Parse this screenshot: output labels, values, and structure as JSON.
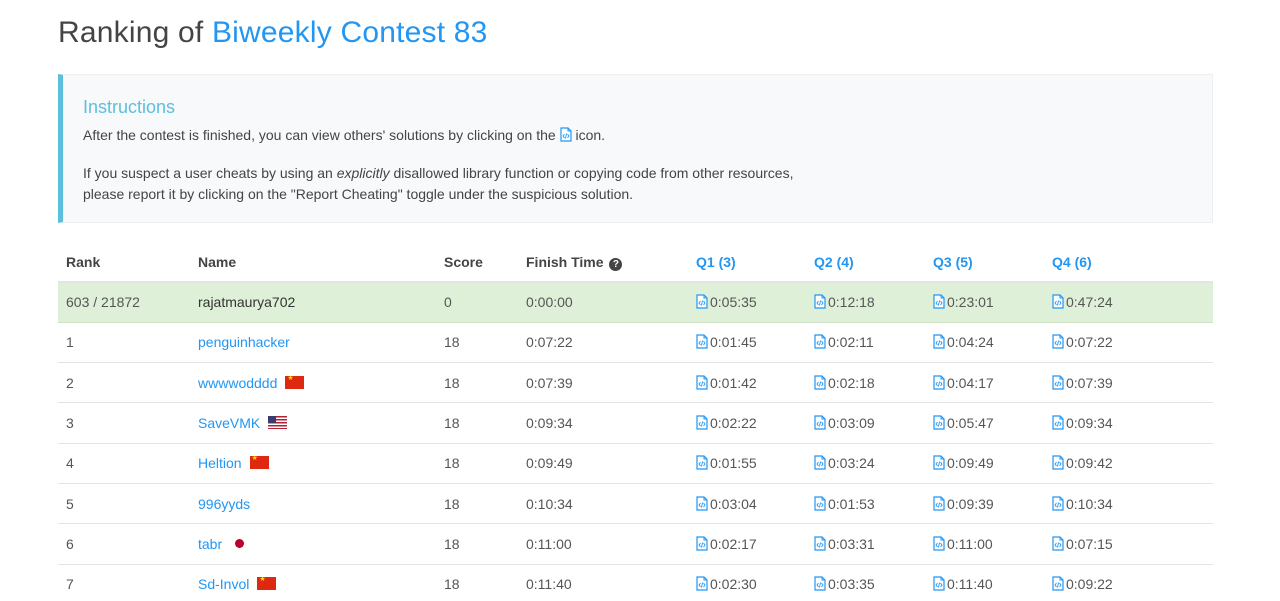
{
  "page": {
    "title_prefix": "Ranking of ",
    "contest_name": "Biweekly Contest 83"
  },
  "instructions": {
    "title": "Instructions",
    "p1_before": "After the contest is finished, you can view others' solutions by clicking on the ",
    "p1_after": " icon.",
    "p2_before": "If you suspect a user cheats by using an ",
    "p2_em": "explicitly",
    "p2_after": " disallowed library function or copying code from other resources,",
    "p2_line2": "please report it by clicking on the \"Report Cheating\" toggle under the suspicious solution."
  },
  "table": {
    "headers": {
      "rank": "Rank",
      "name": "Name",
      "score": "Score",
      "finish_time": "Finish Time",
      "q1": "Q1 (3)",
      "q2": "Q2 (4)",
      "q3": "Q3 (5)",
      "q4": "Q4 (6)"
    },
    "rows": [
      {
        "rank": "603 / 21872",
        "name": "rajatmaurya702",
        "flag": "",
        "score": "0",
        "finish": "0:00:00",
        "q1": "0:05:35",
        "q2": "0:12:18",
        "q3": "0:23:01",
        "q4": "0:47:24"
      },
      {
        "rank": "1",
        "name": "penguinhacker",
        "flag": "",
        "score": "18",
        "finish": "0:07:22",
        "q1": "0:01:45",
        "q2": "0:02:11",
        "q3": "0:04:24",
        "q4": "0:07:22"
      },
      {
        "rank": "2",
        "name": "wwwwodddd",
        "flag": "cn-flag",
        "score": "18",
        "finish": "0:07:39",
        "q1": "0:01:42",
        "q2": "0:02:18",
        "q3": "0:04:17",
        "q4": "0:07:39"
      },
      {
        "rank": "3",
        "name": "SaveVMK",
        "flag": "us-flag",
        "score": "18",
        "finish": "0:09:34",
        "q1": "0:02:22",
        "q2": "0:03:09",
        "q3": "0:05:47",
        "q4": "0:09:34"
      },
      {
        "rank": "4",
        "name": "Heltion",
        "flag": "cn-flag",
        "score": "18",
        "finish": "0:09:49",
        "q1": "0:01:55",
        "q2": "0:03:24",
        "q3": "0:09:49",
        "q4": "0:09:42"
      },
      {
        "rank": "5",
        "name": "996yyds",
        "flag": "",
        "score": "18",
        "finish": "0:10:34",
        "q1": "0:03:04",
        "q2": "0:01:53",
        "q3": "0:09:39",
        "q4": "0:10:34"
      },
      {
        "rank": "6",
        "name": "tabr",
        "flag": "jp-flag",
        "score": "18",
        "finish": "0:11:00",
        "q1": "0:02:17",
        "q2": "0:03:31",
        "q3": "0:11:00",
        "q4": "0:07:15"
      },
      {
        "rank": "7",
        "name": "Sd-Invol",
        "flag": "cn-flag",
        "score": "18",
        "finish": "0:11:40",
        "q1": "0:02:30",
        "q2": "0:03:35",
        "q3": "0:11:40",
        "q4": "0:09:22"
      }
    ]
  },
  "colors": {
    "accent": "#2196f3",
    "instructions_border": "#5bc0de",
    "self_row_bg": "#dff0d8"
  },
  "icons": {
    "solution": "code-file-icon",
    "help": "question-circle-icon"
  }
}
